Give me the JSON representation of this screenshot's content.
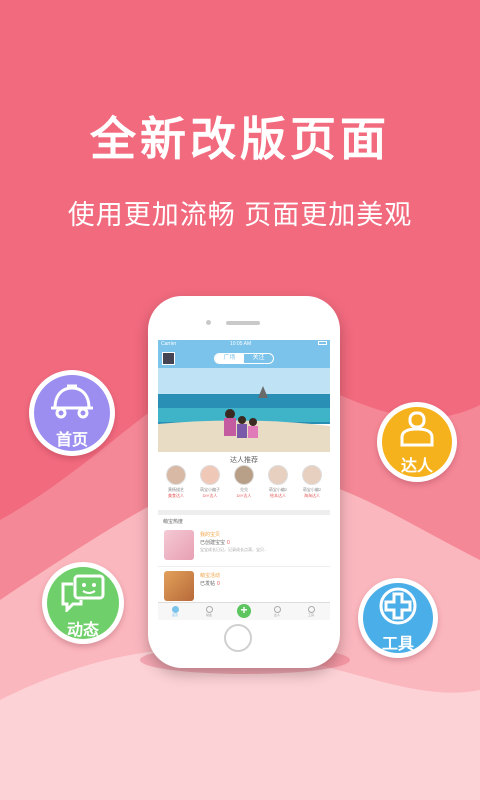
{
  "promo": {
    "headline": "全新改版页面",
    "subline": "使用更加流畅 页面更加美观"
  },
  "features": [
    {
      "label": "首页",
      "icon": "car-icon",
      "color": "#9b8ef0"
    },
    {
      "label": "达人",
      "icon": "person-icon",
      "color": "#f6b21d"
    },
    {
      "label": "动态",
      "icon": "chat-icon",
      "color": "#6fcf6a"
    },
    {
      "label": "工具",
      "icon": "plus-icon",
      "color": "#4aaee8"
    }
  ],
  "phone": {
    "status": {
      "carrier": "Carrier",
      "time": "10:05 AM"
    },
    "segment": [
      "广场",
      "关注"
    ],
    "experts_title": "达人推荐",
    "experts": [
      {
        "name": "黄杨描艺",
        "badge": "美食达人"
      },
      {
        "name": "萌宝小编子",
        "badge": "DIY达人"
      },
      {
        "name": "兑兑",
        "badge": "DIY达人"
      },
      {
        "name": "萌宝小编2",
        "badge": "绘本达人"
      },
      {
        "name": "萌宝小编2",
        "badge": "海淘达人"
      }
    ],
    "list_header": "萌宝热度",
    "items": [
      {
        "title": "我的宝贝",
        "subtitle": "已创建宝宝",
        "count": "0",
        "desc": "宝宝成长日记，记录成长点滴，宝贝..."
      },
      {
        "title": "萌宝活动",
        "subtitle": "已发帖",
        "count": "0",
        "desc": ""
      }
    ],
    "tabs": [
      "首页",
      "动态",
      "",
      "达人",
      "工具"
    ]
  }
}
